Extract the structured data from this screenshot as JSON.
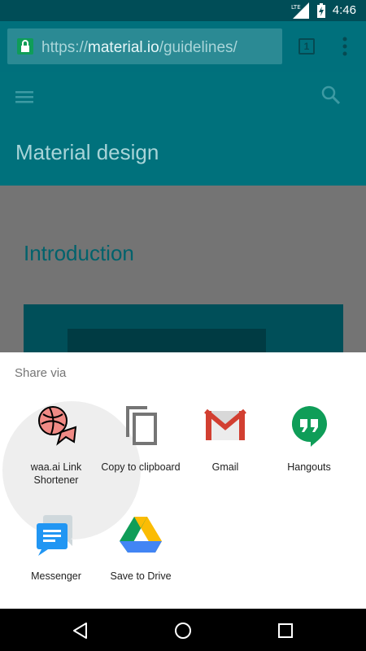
{
  "status_bar": {
    "time": "4:46",
    "network": "LTE"
  },
  "browser": {
    "url_prefix": "https://",
    "url_host": "material.io",
    "url_path": "/guidelines/",
    "tab_count": "1"
  },
  "page": {
    "title": "Material design",
    "intro_heading": "Introduction"
  },
  "share_sheet": {
    "title": "Share via",
    "options": [
      {
        "label": "waa.ai Link Shortener",
        "icon": "waa-ai-icon"
      },
      {
        "label": "Copy to clipboard",
        "icon": "copy-icon"
      },
      {
        "label": "Gmail",
        "icon": "gmail-icon"
      },
      {
        "label": "Hangouts",
        "icon": "hangouts-icon"
      },
      {
        "label": "Messenger",
        "icon": "messenger-icon"
      },
      {
        "label": "Save to Drive",
        "icon": "drive-icon"
      }
    ]
  },
  "colors": {
    "status_bar": "#004d57",
    "toolbar": "#00707c",
    "scrim": "#747474",
    "sheet": "#ffffff"
  }
}
